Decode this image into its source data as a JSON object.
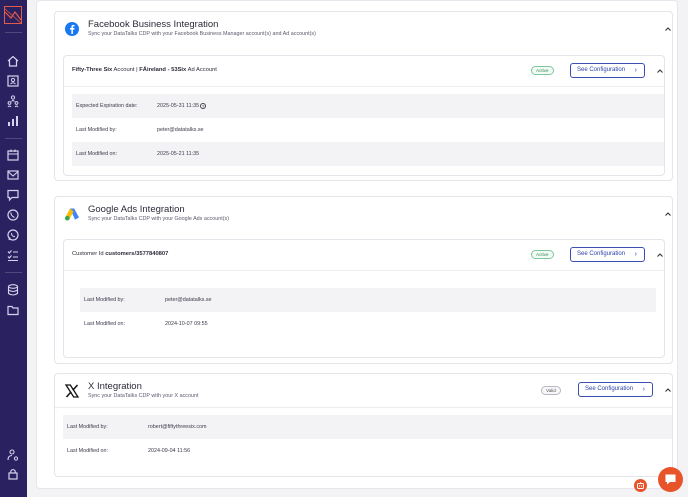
{
  "sidebar": {
    "brand_color": "#2a2260",
    "icons": [
      "home-icon",
      "contacts-icon",
      "audience-icon",
      "analytics-icon",
      "calendar-icon",
      "email-icon",
      "chat-icon",
      "phone-icon",
      "whatsapp-icon",
      "tasks-icon",
      "database-icon",
      "folder-icon",
      "user-settings-icon",
      "lock-icon"
    ]
  },
  "integrations": {
    "facebook": {
      "title": "Facebook Business Integration",
      "subtitle": "Sync your DataTalks CDP with your Facebook Business Manager account(s) and Ad account(s)",
      "account": {
        "business_name": "Fifty-Three Six",
        "business_suffix": " Account | ",
        "ad_name": "FÄireland - 53Six",
        "ad_suffix": " Ad Account",
        "status": "Active",
        "config_label": "See Configuration",
        "rows": [
          {
            "key": "Expected Expiration date:",
            "value": "2025-05-31 11:35"
          },
          {
            "key": "Last Modified by:",
            "value": "peter@datatalks.se"
          },
          {
            "key": "Last Modified on:",
            "value": "2025-05-21 11:35"
          }
        ]
      }
    },
    "google": {
      "title": "Google Ads Integration",
      "subtitle": "Sync your DataTalks CDP with your Google Ads account(s)",
      "account": {
        "customer_prefix": "Customer Id ",
        "customer_id": "customers/3577840807",
        "status": "Active",
        "config_label": "See Configuration",
        "rows": [
          {
            "key": "Last Modified by:",
            "value": "peter@datatalks.se"
          },
          {
            "key": "Last Modified on:",
            "value": "2024-10-07 09:55"
          }
        ]
      }
    },
    "x": {
      "title": "X Integration",
      "subtitle": "Sync your DataTalks CDP with your X account",
      "status": "Valid",
      "config_label": "See Configuration",
      "rows": [
        {
          "key": "Last Modified by:",
          "value": "robert@fiftythreesix.com"
        },
        {
          "key": "Last Modified on:",
          "value": "2024-09-04 11:56"
        }
      ]
    }
  },
  "colors": {
    "accent": "#2f44a8",
    "active_badge": "#2f8a54",
    "chat_fab": "#e8542a"
  }
}
